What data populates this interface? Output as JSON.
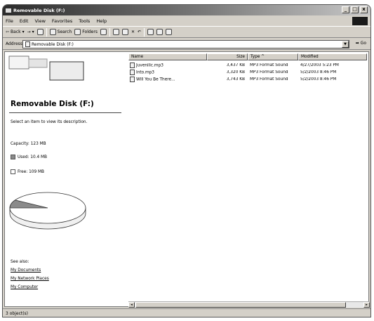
{
  "window": {
    "title": "Removable Disk (F:)",
    "buttons": [
      "_",
      "□",
      "x"
    ]
  },
  "menu": [
    "File",
    "Edit",
    "View",
    "Favorites",
    "Tools",
    "Help"
  ],
  "toolbar": {
    "back": "Back",
    "forward": "→",
    "up": "↑",
    "search": "Search",
    "folders": "Folders"
  },
  "address": {
    "label": "Address",
    "value": "Removable Disk (F:)",
    "go": "Go"
  },
  "left_pane": {
    "drive_title": "Removable Disk (F:)",
    "description": "Select an item to view its description.",
    "capacity": "Capacity: 123 MB",
    "used": "Used: 10.4 MB",
    "free": "Free: 109 MB",
    "used_fraction": 0.085,
    "used_color": "#8a8a8a",
    "free_color": "#ffffff",
    "see_also": "See also:",
    "links": [
      "My Documents",
      "My Network Places",
      "My Computer"
    ]
  },
  "columns": [
    "Name",
    "Size",
    "Type",
    "Modified"
  ],
  "files": [
    {
      "name": "Juvenilic.mp3",
      "size": "3,437 KB",
      "type": "MP3 Format Sound",
      "modified": "4/27/2003 5:23 PM"
    },
    {
      "name": "Into.mp3",
      "size": "3,320 KB",
      "type": "MP3 Format Sound",
      "modified": "5/2/2003 8:46 PM"
    },
    {
      "name": "Will You Be There...",
      "size": "3,743 KB",
      "type": "MP3 Format Sound",
      "modified": "5/2/2003 8:46 PM"
    }
  ],
  "status": "3 object(s)"
}
